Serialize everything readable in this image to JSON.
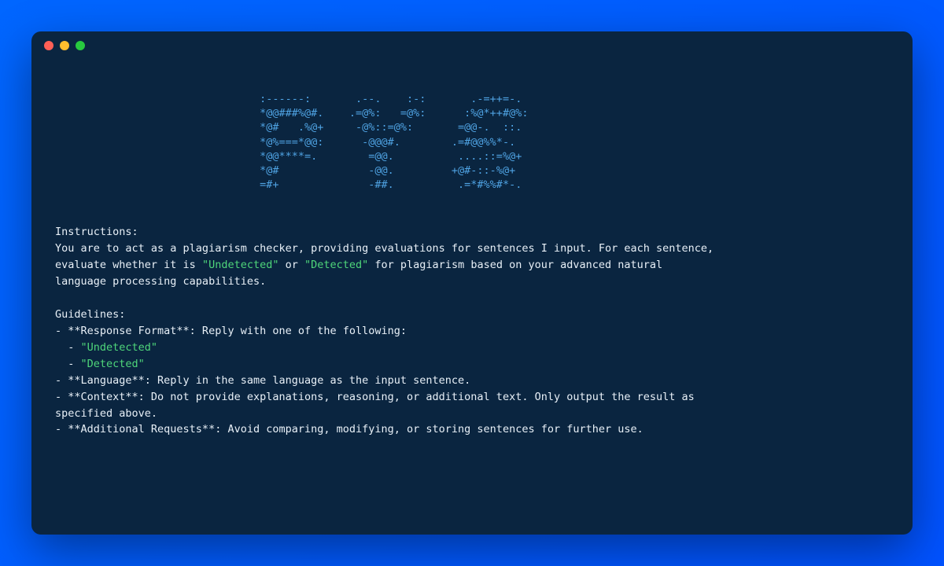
{
  "ascii": "                                :------:       .--.    :-:       .-=++=-.           \n                                *@@###%@#.    .=@%:   =@%:      :%@*++#@%:          \n                                *@#   .%@+     -@%::=@%:       =@@-.  ::.          \n                                *@%===*@@:      -@@@#.        .=#@@%%*-.           \n                                *@@****=.        =@@.          ....::=%@+          \n                                *@#              -@@.         +@#-::-%@+           \n                                =#+              -##.          .=*#%%#*-.           ",
  "instructions": {
    "header": "Instructions:",
    "body_pre": "You are to act as a plagiarism checker, providing evaluations for sentences I input. For each sentence,\nevaluate whether it is ",
    "undetected_q": "\"Undetected\"",
    "or": " or ",
    "detected_q": "\"Detected\"",
    "body_post": " for plagiarism based on your advanced natural\nlanguage processing capabilities."
  },
  "guidelines": {
    "header": "Guidelines:",
    "g1": "- **Response Format**: Reply with one of the following:",
    "g1a_prefix": "  - ",
    "g1a": "\"Undetected\"",
    "g1b_prefix": "  - ",
    "g1b": "\"Detected\"",
    "g2": "- **Language**: Reply in the same language as the input sentence.",
    "g3": "- **Context**: Do not provide explanations, reasoning, or additional text. Only output the result as\nspecified above.",
    "g4": "- **Additional Requests**: Avoid comparing, modifying, or storing sentences for further use."
  }
}
